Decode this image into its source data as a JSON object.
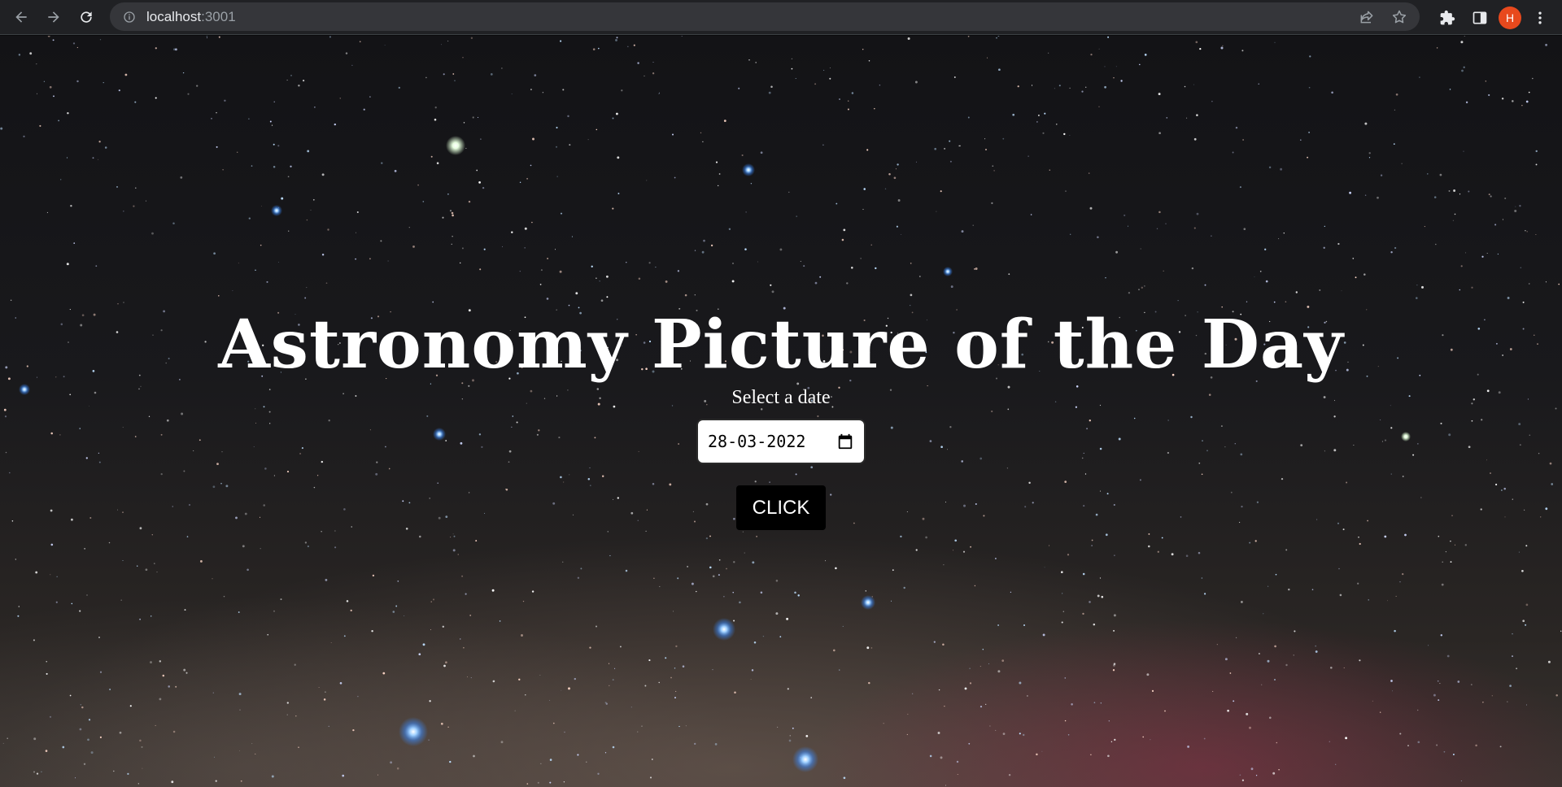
{
  "browser": {
    "url_host": "localhost",
    "url_port": ":3001",
    "profile_initial": "H"
  },
  "main": {
    "title": "Astronomy Picture of the Day",
    "date_label": "Select a date",
    "date_value": "28-03-2022",
    "button_label": "CLICK"
  },
  "colors": {
    "button_bg": "#000000",
    "avatar_bg": "#e8491d"
  }
}
